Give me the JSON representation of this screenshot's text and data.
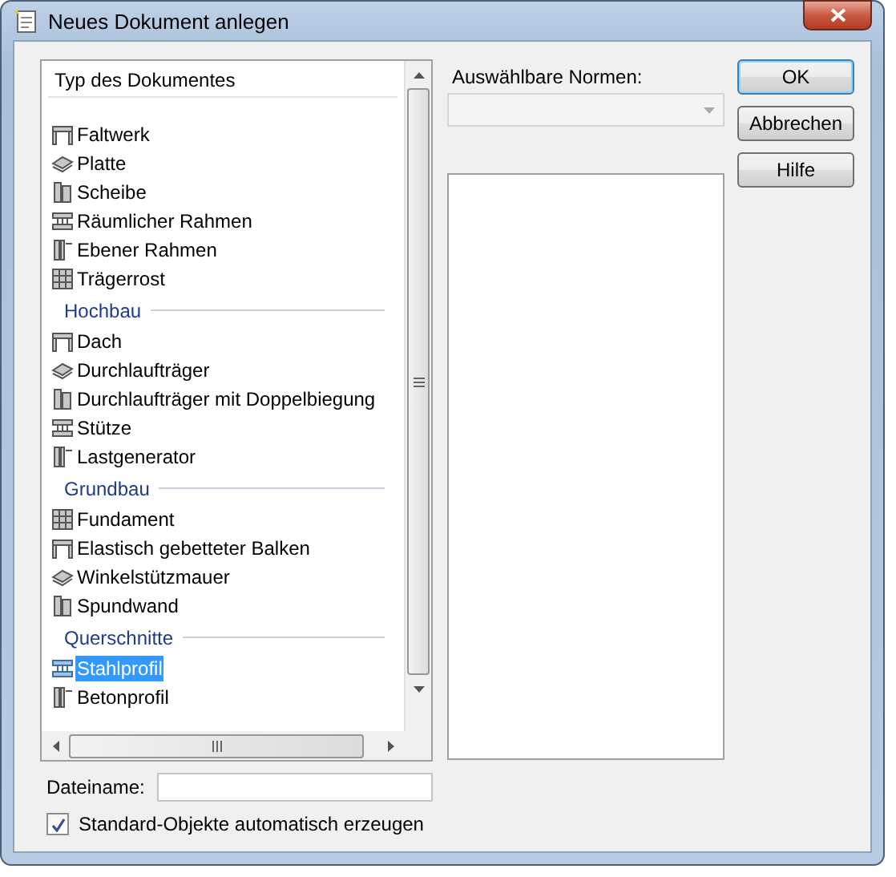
{
  "window": {
    "title": "Neues Dokument anlegen"
  },
  "document_types": {
    "header": "Typ des Dokumentes",
    "items": [
      {
        "kind": "item",
        "label": "Faltwerk",
        "selected": false
      },
      {
        "kind": "item",
        "label": "Platte",
        "selected": false
      },
      {
        "kind": "item",
        "label": "Scheibe",
        "selected": false
      },
      {
        "kind": "item",
        "label": "Räumlicher Rahmen",
        "selected": false
      },
      {
        "kind": "item",
        "label": "Ebener Rahmen",
        "selected": false
      },
      {
        "kind": "item",
        "label": "Trägerrost",
        "selected": false
      },
      {
        "kind": "group",
        "label": "Hochbau"
      },
      {
        "kind": "item",
        "label": "Dach",
        "selected": false
      },
      {
        "kind": "item",
        "label": "Durchlaufträger",
        "selected": false
      },
      {
        "kind": "item",
        "label": "Durchlaufträger mit Doppelbiegung",
        "selected": false
      },
      {
        "kind": "item",
        "label": "Stütze",
        "selected": false
      },
      {
        "kind": "item",
        "label": "Lastgenerator",
        "selected": false
      },
      {
        "kind": "group",
        "label": "Grundbau"
      },
      {
        "kind": "item",
        "label": "Fundament",
        "selected": false
      },
      {
        "kind": "item",
        "label": "Elastisch gebetteter Balken",
        "selected": false
      },
      {
        "kind": "item",
        "label": "Winkelstützmauer",
        "selected": false
      },
      {
        "kind": "item",
        "label": "Spundwand",
        "selected": false
      },
      {
        "kind": "group",
        "label": "Querschnitte"
      },
      {
        "kind": "item",
        "label": "Stahlprofil",
        "selected": true
      },
      {
        "kind": "item",
        "label": "Betonprofil",
        "selected": false
      }
    ]
  },
  "norms": {
    "label": "Auswählbare Normen:",
    "disabled": true
  },
  "filename": {
    "label": "Dateiname:"
  },
  "auto_create": {
    "label": "Standard-Objekte automatisch erzeugen",
    "checked": true
  },
  "buttons": [
    {
      "label": "OK",
      "default": true
    },
    {
      "label": "Abbrechen",
      "default": false
    },
    {
      "label": "Hilfe",
      "default": false
    }
  ]
}
